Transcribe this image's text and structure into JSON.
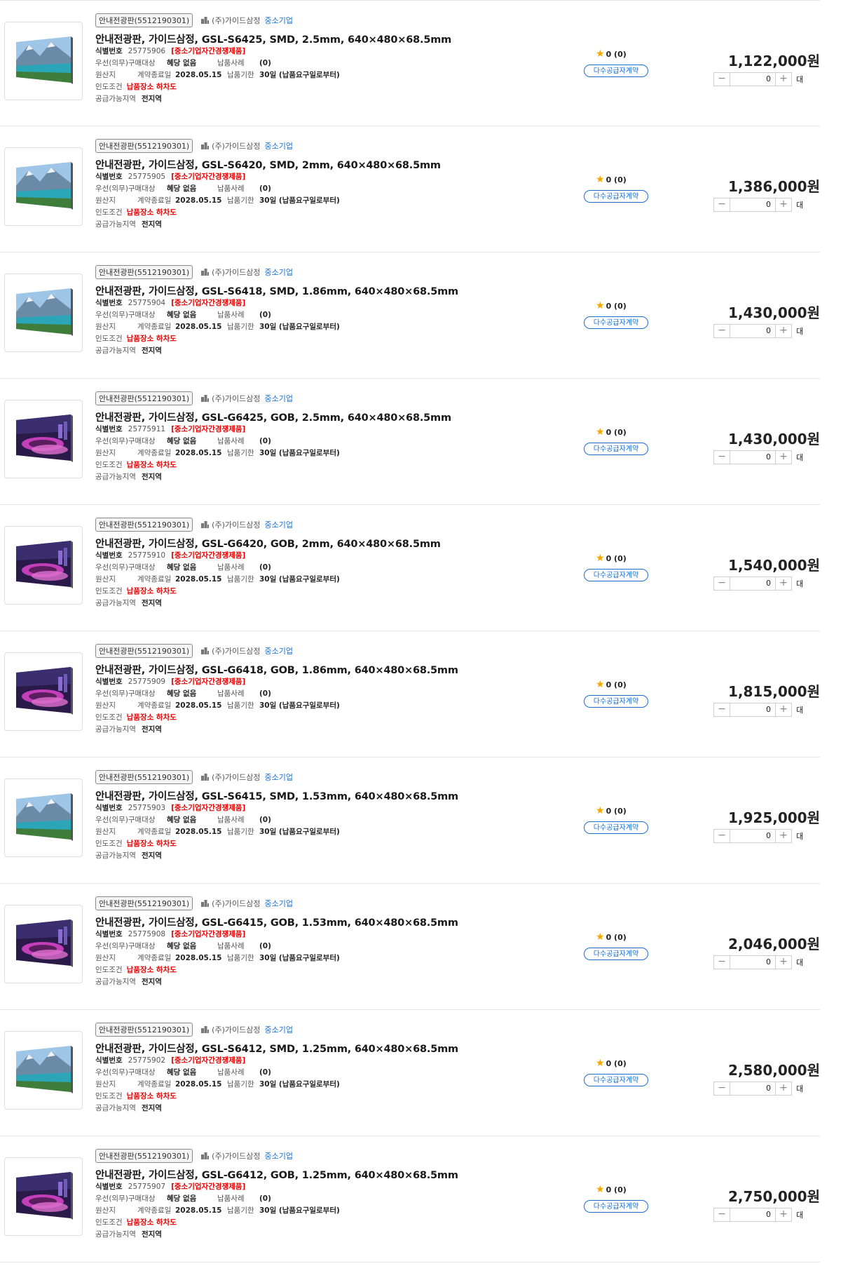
{
  "labels": {
    "id_label": "식별번호",
    "competition": "[중소기업자간경쟁제품]",
    "priority_label": "우선(의무)구매대상",
    "priority_value": "혜당 없음",
    "cases_label": "납품사례",
    "cases_value": "(0)",
    "origin_label": "원산지",
    "contract_end_label": "계약종료일",
    "contract_end_value": "2028.05.15",
    "deadline_label": "납품기한",
    "deadline_value": "30일 (납품요구일로부터)",
    "delivery_label": "인도조건",
    "delivery_value": "납품장소 하차도",
    "region_label": "공급가능지역",
    "region_value": "전지역",
    "category_tag": "안내전광판(5512190301)",
    "seller": "(주)가이드삼정",
    "sme_badge": "중소기업",
    "rating": "0 (0)",
    "contract_badge": "다수공급자계약",
    "qty_value": "0",
    "unit": "대",
    "minus": "−",
    "plus": "+"
  },
  "colors": {
    "accent": "#1a6fd1",
    "red": "#e60000",
    "star": "#f6a700"
  },
  "products": [
    {
      "title": "안내전광판, 가이드삼정, GSL-S6425, SMD, 2.5mm, 640×480×68.5mm",
      "id": "25775906",
      "price": "1,122,000원",
      "image": "mountain-lake"
    },
    {
      "title": "안내전광판, 가이드삼정, GSL-S6420, SMD, 2mm, 640×480×68.5mm",
      "id": "25775905",
      "price": "1,386,000원",
      "image": "mountain-lake"
    },
    {
      "title": "안내전광판, 가이드삼정, GSL-S6418, SMD, 1.86mm, 640×480×68.5mm",
      "id": "25775904",
      "price": "1,430,000원",
      "image": "mountain-lake"
    },
    {
      "title": "안내전광판, 가이드삼정, GSL-G6425, GOB, 2.5mm, 640×480×68.5mm",
      "id": "25775911",
      "price": "1,430,000원",
      "image": "city-night"
    },
    {
      "title": "안내전광판, 가이드삼정, GSL-G6420, GOB, 2mm, 640×480×68.5mm",
      "id": "25775910",
      "price": "1,540,000원",
      "image": "city-night"
    },
    {
      "title": "안내전광판, 가이드삼정, GSL-G6418, GOB, 1.86mm, 640×480×68.5mm",
      "id": "25775909",
      "price": "1,815,000원",
      "image": "city-night"
    },
    {
      "title": "안내전광판, 가이드삼정, GSL-S6415, SMD, 1.53mm, 640×480×68.5mm",
      "id": "25775903",
      "price": "1,925,000원",
      "image": "mountain-lake"
    },
    {
      "title": "안내전광판, 가이드삼정, GSL-G6415, GOB, 1.53mm, 640×480×68.5mm",
      "id": "25775908",
      "price": "2,046,000원",
      "image": "city-night"
    },
    {
      "title": "안내전광판, 가이드삼정, GSL-S6412, SMD, 1.25mm, 640×480×68.5mm",
      "id": "25775902",
      "price": "2,580,000원",
      "image": "mountain-lake"
    },
    {
      "title": "안내전광판, 가이드삼정, GSL-G6412, GOB, 1.25mm, 640×480×68.5mm",
      "id": "25775907",
      "price": "2,750,000원",
      "image": "city-night"
    }
  ]
}
